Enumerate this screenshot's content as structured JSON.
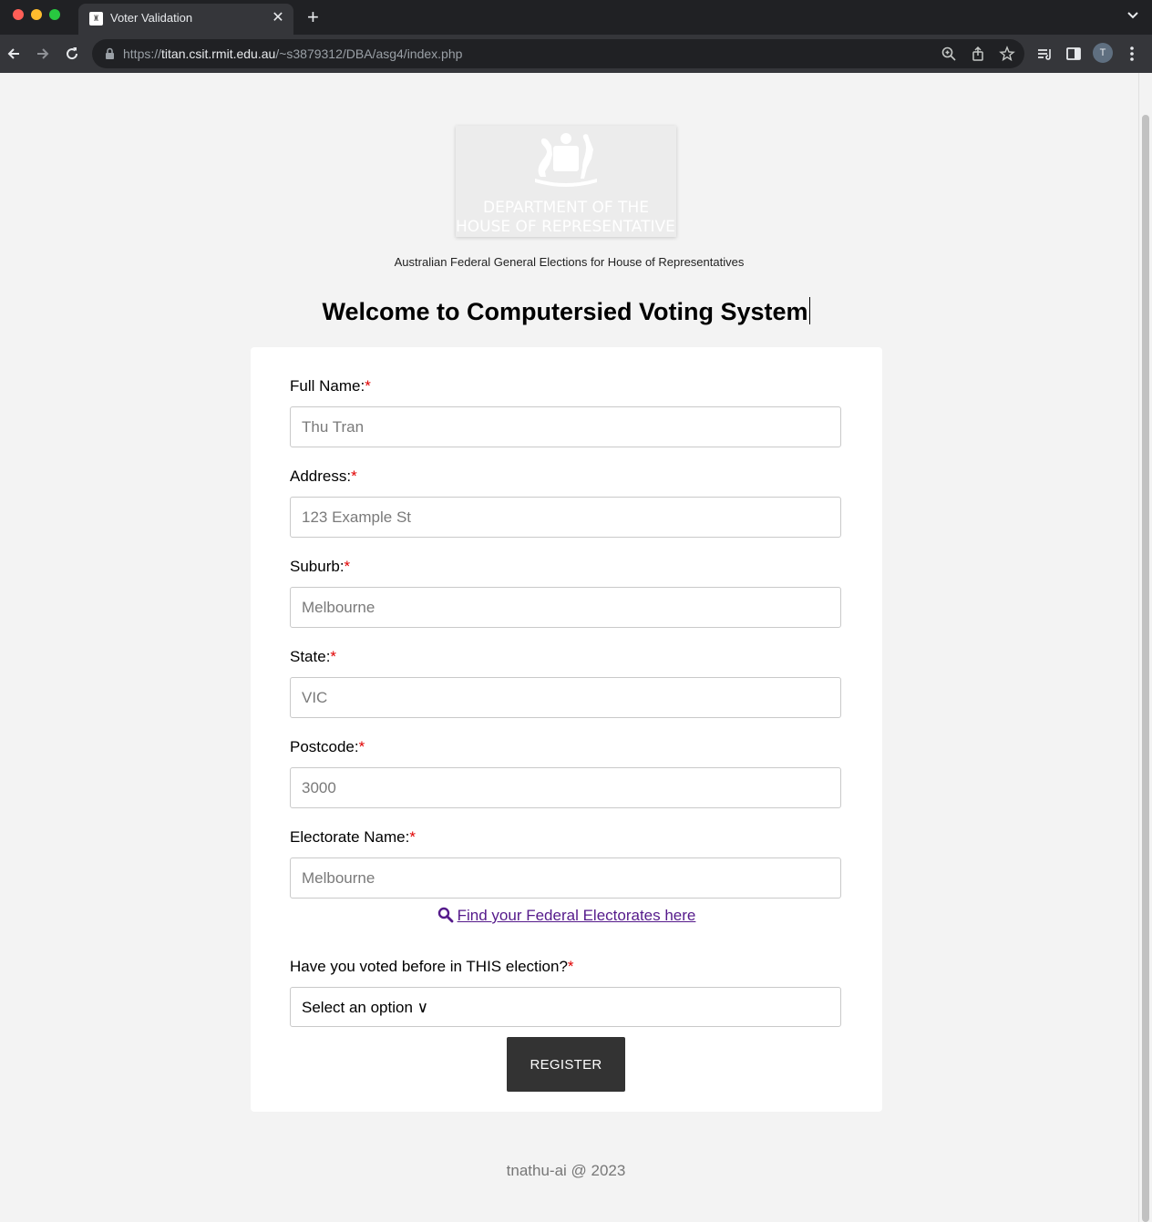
{
  "browser": {
    "tab_title": "Voter Validation",
    "tab_close": "✕",
    "new_tab": "+",
    "url_scheme": "https://",
    "url_host": "titan.csit.rmit.edu.au",
    "url_path": "/~s3879312/DBA/asg4/index.php",
    "profile_initial": "T"
  },
  "logo": {
    "line1": "DEPARTMENT OF THE",
    "line2": "HOUSE OF REPRESENTATIVES"
  },
  "page": {
    "subtitle": "Australian Federal General Elections for House of Representatives",
    "heading": "Welcome to Computersied Voting System",
    "footer": "tnathu-ai @ 2023"
  },
  "form": {
    "required_mark": "*",
    "fields": [
      {
        "label": "Full Name:",
        "placeholder": "Thu Tran"
      },
      {
        "label": "Address:",
        "placeholder": "123 Example St"
      },
      {
        "label": "Suburb:",
        "placeholder": "Melbourne"
      },
      {
        "label": "State:",
        "placeholder": "VIC"
      },
      {
        "label": "Postcode:",
        "placeholder": "3000"
      },
      {
        "label": "Electorate Name:",
        "placeholder": "Melbourne"
      }
    ],
    "find_link": "Find your Federal Electorates here",
    "voted_label": "Have you voted before in THIS election?",
    "voted_select": "Select an option ∨",
    "register_label": "REGISTER"
  }
}
